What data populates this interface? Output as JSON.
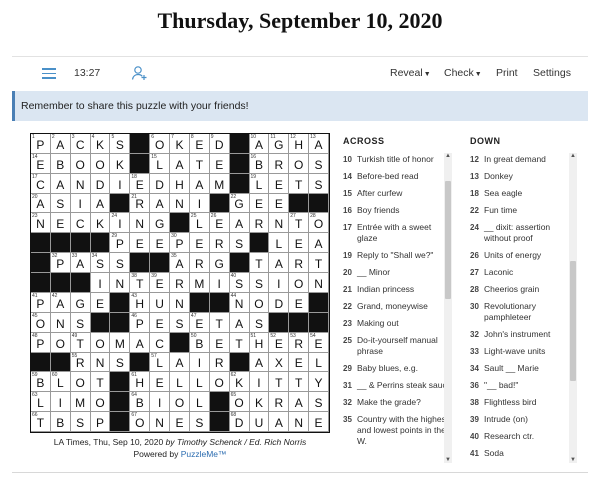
{
  "page": {
    "title": "Thursday, September 10, 2020"
  },
  "toolbar": {
    "menu_icon": "hamburger-icon",
    "timer": "13:27",
    "add_user_icon": "add-user-icon",
    "reveal": "Reveal",
    "check": "Check",
    "print": "Print",
    "settings": "Settings"
  },
  "banner": {
    "text": "Remember to share this puzzle with your friends!"
  },
  "grid": {
    "rows": [
      "PACKS#OKED#AGHA",
      "EBOOK#LATE#BROS",
      "CANDIEDHAM#LETS",
      "ASIA#RANI#GEE##",
      "NECKING#LEARNTO",
      "####PEEPERS#LEA",
      "#PASS##ARG#TART",
      "###INTERMISSIONS",
      "PAGE#HUN##NODE#",
      "ONS##PESETAS###",
      "POTOMAC#BETHERE",
      "##RNS#LAIR#AXEL",
      "BLOT#HELLOKITTY",
      "LIMO#BIOL#OKRAS",
      "TBSP#ONES#DUANE"
    ],
    "numbers": [
      [
        1,
        2,
        3,
        4,
        5,
        0,
        6,
        7,
        8,
        9,
        0,
        10,
        11,
        12,
        13
      ],
      [
        14,
        0,
        0,
        0,
        0,
        0,
        15,
        0,
        0,
        0,
        0,
        16,
        0,
        0,
        0
      ],
      [
        17,
        0,
        0,
        0,
        0,
        18,
        0,
        0,
        0,
        0,
        0,
        19,
        0,
        0,
        0
      ],
      [
        20,
        0,
        0,
        0,
        0,
        21,
        0,
        0,
        0,
        0,
        22,
        0,
        0,
        0,
        0
      ],
      [
        23,
        0,
        0,
        0,
        24,
        0,
        0,
        0,
        25,
        26,
        0,
        0,
        0,
        27,
        28
      ],
      [
        0,
        0,
        0,
        0,
        29,
        0,
        0,
        30,
        0,
        0,
        0,
        31,
        0,
        0,
        0
      ],
      [
        0,
        32,
        33,
        34,
        0,
        0,
        0,
        35,
        0,
        0,
        36,
        0,
        0,
        0,
        0
      ],
      [
        0,
        0,
        37,
        0,
        0,
        38,
        39,
        0,
        0,
        0,
        40,
        0,
        0,
        0,
        0
      ],
      [
        41,
        42,
        0,
        0,
        0,
        43,
        0,
        0,
        0,
        0,
        44,
        0,
        0,
        0,
        0
      ],
      [
        45,
        0,
        0,
        0,
        0,
        46,
        0,
        0,
        47,
        0,
        0,
        0,
        0,
        0,
        0
      ],
      [
        48,
        0,
        49,
        0,
        0,
        0,
        0,
        0,
        50,
        0,
        0,
        51,
        52,
        53,
        54
      ],
      [
        0,
        0,
        55,
        0,
        0,
        56,
        57,
        0,
        0,
        0,
        58,
        0,
        0,
        0,
        0
      ],
      [
        59,
        60,
        0,
        0,
        0,
        61,
        0,
        0,
        0,
        0,
        62,
        0,
        0,
        0,
        0
      ],
      [
        63,
        0,
        0,
        0,
        0,
        64,
        0,
        0,
        0,
        0,
        65,
        0,
        0,
        0,
        0
      ],
      [
        66,
        0,
        0,
        0,
        0,
        67,
        0,
        0,
        0,
        0,
        68,
        0,
        0,
        0,
        0
      ]
    ]
  },
  "credit": {
    "line1_prefix": "LA Times, Thu, Sep 10, 2020 ",
    "line1_author": "by Timothy Schenck / Ed. Rich Norris",
    "line2_prefix": "Powered by ",
    "line2_link": "PuzzleMe™"
  },
  "across": {
    "heading": "ACROSS",
    "clues": [
      {
        "num": "10",
        "text": "Turkish title of honor"
      },
      {
        "num": "14",
        "text": "Before-bed read"
      },
      {
        "num": "15",
        "text": "After curfew"
      },
      {
        "num": "16",
        "text": "Boy friends"
      },
      {
        "num": "17",
        "text": "Entrée with a sweet glaze"
      },
      {
        "num": "19",
        "text": "Reply to \"Shall we?\""
      },
      {
        "num": "20",
        "text": "__ Minor"
      },
      {
        "num": "21",
        "text": "Indian princess"
      },
      {
        "num": "22",
        "text": "Grand, moneywise"
      },
      {
        "num": "23",
        "text": "Making out"
      },
      {
        "num": "25",
        "text": "Do-it-yourself manual phrase"
      },
      {
        "num": "29",
        "text": "Baby blues, e.g."
      },
      {
        "num": "31",
        "text": "__ & Perrins steak sauce"
      },
      {
        "num": "32",
        "text": "Make the grade?"
      },
      {
        "num": "35",
        "text": "Country with the highest and lowest points in the W."
      }
    ]
  },
  "down": {
    "heading": "DOWN",
    "clues": [
      {
        "num": "12",
        "text": "In great demand"
      },
      {
        "num": "13",
        "text": "Donkey"
      },
      {
        "num": "18",
        "text": "Sea eagle"
      },
      {
        "num": "22",
        "text": "Fun time"
      },
      {
        "num": "24",
        "text": "__ dixit: assertion without proof"
      },
      {
        "num": "26",
        "text": "Units of energy"
      },
      {
        "num": "27",
        "text": "Laconic"
      },
      {
        "num": "28",
        "text": "Cheerios grain"
      },
      {
        "num": "30",
        "text": "Revolutionary pamphleteer"
      },
      {
        "num": "32",
        "text": "John's instrument"
      },
      {
        "num": "33",
        "text": "Light-wave units"
      },
      {
        "num": "34",
        "text": "Sault __ Marie"
      },
      {
        "num": "36",
        "text": "\"__ bad!\""
      },
      {
        "num": "38",
        "text": "Flightless bird"
      },
      {
        "num": "39",
        "text": "Intrude (on)"
      },
      {
        "num": "40",
        "text": "Research ctr."
      },
      {
        "num": "41",
        "text": "Soda"
      }
    ]
  }
}
